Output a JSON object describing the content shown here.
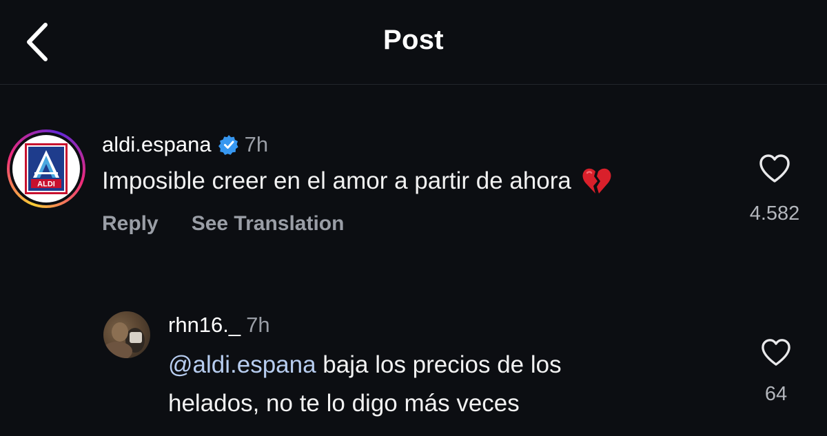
{
  "header": {
    "title": "Post"
  },
  "comment": {
    "username": "aldi.espana",
    "verified": true,
    "time": "7h",
    "text": "Imposible creer en el amor a partir de ahora",
    "emoji": "broken-heart-icon",
    "actions": {
      "reply": "Reply",
      "see_translation": "See Translation"
    },
    "likes": "4.582",
    "avatar_logo_text": "ALDI"
  },
  "reply": {
    "username": "rhn16._",
    "time": "7h",
    "mention": "@aldi.espana",
    "text_line1": " baja los precios de los",
    "text_line2": "helados, no te lo digo más veces",
    "likes": "64"
  },
  "colors": {
    "background": "#0c0e12",
    "verified": "#3797f0",
    "mention": "#b7cdf0",
    "muted": "#9a9ea6"
  }
}
